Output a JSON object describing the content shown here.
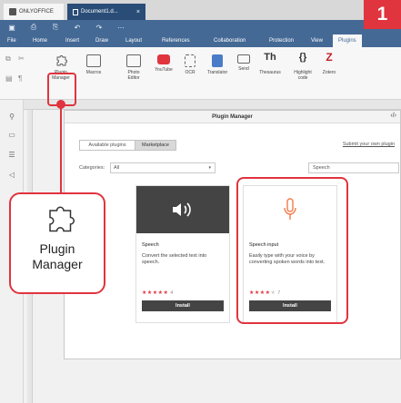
{
  "titlebar": {
    "app_tab": "ONLYOFFICE",
    "doc_tab": "Document1.d...",
    "close": "×"
  },
  "menu": [
    "File",
    "Home",
    "Insert",
    "Draw",
    "Layout",
    "References",
    "Collaboration",
    "Protection",
    "View",
    "Plugins"
  ],
  "ribbon": {
    "plugin_manager": "Plugin Manager",
    "macros": "Macros",
    "photo_editor": "Photo Editor",
    "youtube": "YouTube",
    "ocr": "OCR",
    "translator": "Translator",
    "send": "Send",
    "thesaurus": "Thesaurus",
    "highlight_code": "Highlight code",
    "zotero": "Zotero",
    "th_glyph": "Th",
    "braces_glyph": "{}",
    "z_glyph": "Z"
  },
  "dialog": {
    "title": "Plugin Manager",
    "tab_available": "Available plugins",
    "tab_marketplace": "Marketplace",
    "submit_link": "Submit your own plugin",
    "categories_label": "Categories:",
    "categories_value": "All",
    "search_value": "Speech"
  },
  "cards": [
    {
      "title": "Speech",
      "description": "Convert the selected text into speech.",
      "stars_on": "★★★★★",
      "stars_off": "",
      "count": "4",
      "button": "Install"
    },
    {
      "title": "Speech input",
      "description": "Easily type with your voice by converting spoken words into text.",
      "stars_on": "★★★★",
      "stars_off": "★",
      "count": "7",
      "button": "Install"
    }
  ],
  "callout": {
    "label_line1": "Plugin",
    "label_line2": "Manager"
  },
  "badge": "1",
  "colors": {
    "accent_red": "#e0343e",
    "header_blue": "#446995",
    "speech_card_bg": "#444444",
    "mic_orange": "#f07b4a"
  }
}
